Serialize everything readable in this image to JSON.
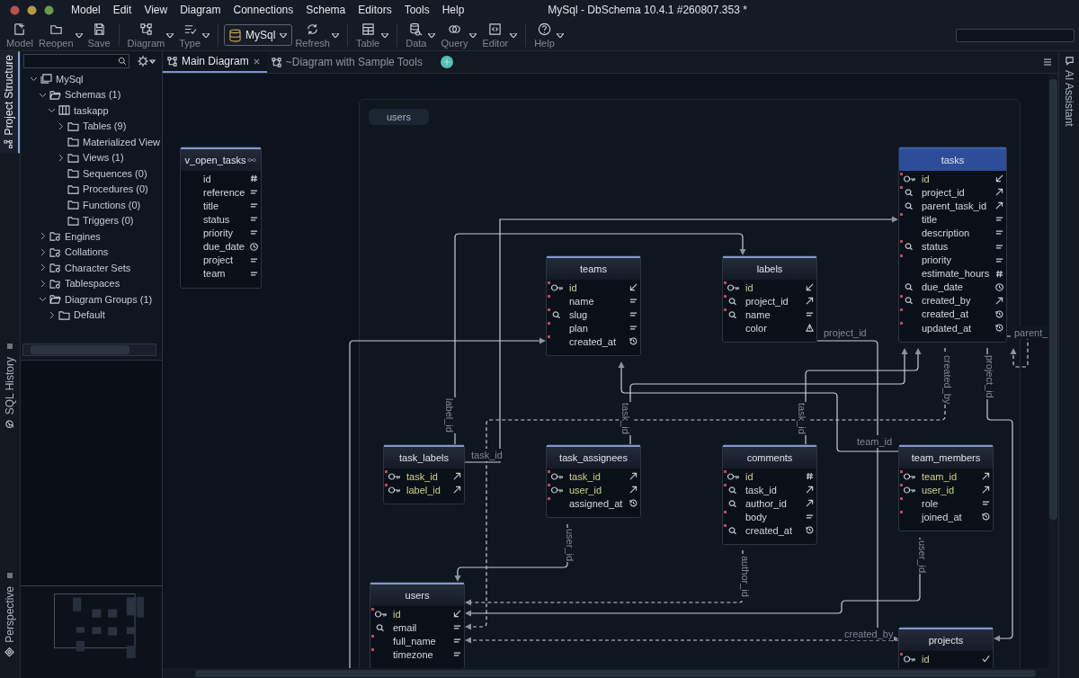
{
  "window": {
    "title": "MySql - DbSchema 10.4.1 #260807.353 *"
  },
  "menu": [
    "Model",
    "Edit",
    "View",
    "Diagram",
    "Connections",
    "Schema",
    "Editors",
    "Tools",
    "Help"
  ],
  "toolbar": [
    {
      "label": "Model",
      "kind": "button",
      "dropdown": false
    },
    {
      "label": "Reopen",
      "kind": "button",
      "dropdown": true
    },
    {
      "label": "Save",
      "kind": "button",
      "dropdown": false
    },
    {
      "label": "Diagram",
      "kind": "button",
      "dropdown": true
    },
    {
      "label": "Type",
      "kind": "button",
      "dropdown": true
    },
    {
      "label": "MySql",
      "kind": "selector",
      "dropdown": true
    },
    {
      "label": "Refresh",
      "kind": "button",
      "dropdown": true
    },
    {
      "label": "Table",
      "kind": "button",
      "dropdown": true
    },
    {
      "label": "Data",
      "kind": "button",
      "dropdown": true
    },
    {
      "label": "Query",
      "kind": "button",
      "dropdown": true
    },
    {
      "label": "Editor",
      "kind": "button",
      "dropdown": true
    },
    {
      "label": "Help",
      "kind": "button",
      "dropdown": true
    }
  ],
  "side_tabs_left": [
    {
      "label": "Project Structure",
      "selected": true
    },
    {
      "label": "SQL History",
      "selected": false
    },
    {
      "label": "Perspective",
      "selected": false
    }
  ],
  "side_tabs_right": [
    {
      "label": "AI Assistant",
      "selected": false
    }
  ],
  "tree": [
    {
      "label": "MySql",
      "kind": "connection",
      "expanded": true,
      "children": [
        {
          "label": "Schemas (1)",
          "kind": "folder-open",
          "expanded": true,
          "children": [
            {
              "label": "taskapp",
              "kind": "schema",
              "expanded": true,
              "children": [
                {
                  "label": "Tables (9)",
                  "kind": "folder",
                  "expanded": false
                },
                {
                  "label": "Materialized View",
                  "kind": "folder"
                },
                {
                  "label": "Views (1)",
                  "kind": "folder",
                  "expanded": false
                },
                {
                  "label": "Sequences (0)",
                  "kind": "folder"
                },
                {
                  "label": "Procedures (0)",
                  "kind": "folder"
                },
                {
                  "label": "Functions (0)",
                  "kind": "folder"
                },
                {
                  "label": "Triggers (0)",
                  "kind": "folder"
                }
              ]
            }
          ]
        },
        {
          "label": "Engines",
          "kind": "folder-special",
          "expanded": false
        },
        {
          "label": "Collations",
          "kind": "folder-special",
          "expanded": false
        },
        {
          "label": "Character Sets",
          "kind": "folder-special",
          "expanded": false
        },
        {
          "label": "Tablespaces",
          "kind": "folder-special",
          "expanded": false
        },
        {
          "label": "Diagram Groups (1)",
          "kind": "folder-open",
          "expanded": true,
          "children": [
            {
              "label": "Default",
              "kind": "folder",
              "expanded": false
            }
          ]
        }
      ]
    }
  ],
  "tabs": [
    {
      "label": "Main Diagram",
      "selected": true
    },
    {
      "label": "~Diagram with Sample Tools",
      "selected": false
    }
  ],
  "diagram": {
    "group": {
      "label": "users"
    },
    "tables": [
      {
        "name": "v_open_tasks",
        "kind": "view",
        "selected": false,
        "columns": [
          {
            "name": "id",
            "primary_key": false,
            "indexed": false,
            "kind": "number",
            "required": false
          },
          {
            "name": "reference",
            "primary_key": false,
            "indexed": false,
            "kind": "text",
            "required": false
          },
          {
            "name": "title",
            "primary_key": false,
            "indexed": false,
            "kind": "text",
            "required": false
          },
          {
            "name": "status",
            "primary_key": false,
            "indexed": false,
            "kind": "text",
            "required": false
          },
          {
            "name": "priority",
            "primary_key": false,
            "indexed": false,
            "kind": "text",
            "required": false
          },
          {
            "name": "due_date",
            "primary_key": false,
            "indexed": false,
            "kind": "date",
            "required": false
          },
          {
            "name": "project",
            "primary_key": false,
            "indexed": false,
            "kind": "text",
            "required": false
          },
          {
            "name": "team",
            "primary_key": false,
            "indexed": false,
            "kind": "text",
            "required": false
          }
        ]
      },
      {
        "name": "tasks",
        "kind": "table",
        "selected": true,
        "columns": [
          {
            "name": "id",
            "primary_key": true,
            "indexed": false,
            "kind": "pk",
            "required": true
          },
          {
            "name": "project_id",
            "primary_key": false,
            "indexed": true,
            "kind": "fk",
            "required": true
          },
          {
            "name": "parent_task_id",
            "primary_key": false,
            "indexed": true,
            "kind": "fk",
            "required": false
          },
          {
            "name": "title",
            "primary_key": false,
            "indexed": false,
            "kind": "text",
            "required": true
          },
          {
            "name": "description",
            "primary_key": false,
            "indexed": false,
            "kind": "text",
            "required": false
          },
          {
            "name": "status",
            "primary_key": false,
            "indexed": true,
            "kind": "text",
            "required": true
          },
          {
            "name": "priority",
            "primary_key": false,
            "indexed": false,
            "kind": "text",
            "required": true
          },
          {
            "name": "estimate_hours",
            "primary_key": false,
            "indexed": false,
            "kind": "number",
            "required": false
          },
          {
            "name": "due_date",
            "primary_key": false,
            "indexed": true,
            "kind": "date",
            "required": false
          },
          {
            "name": "created_by",
            "primary_key": false,
            "indexed": true,
            "kind": "fk",
            "required": true
          },
          {
            "name": "created_at",
            "primary_key": false,
            "indexed": false,
            "kind": "history",
            "required": true
          },
          {
            "name": "updated_at",
            "primary_key": false,
            "indexed": false,
            "kind": "history",
            "required": true
          }
        ]
      },
      {
        "name": "teams",
        "kind": "table",
        "selected": false,
        "columns": [
          {
            "name": "id",
            "primary_key": true,
            "indexed": false,
            "kind": "pk",
            "required": true
          },
          {
            "name": "name",
            "primary_key": false,
            "indexed": false,
            "kind": "text",
            "required": true
          },
          {
            "name": "slug",
            "primary_key": false,
            "indexed": true,
            "kind": "text",
            "required": true
          },
          {
            "name": "plan",
            "primary_key": false,
            "indexed": false,
            "kind": "text",
            "required": true
          },
          {
            "name": "created_at",
            "primary_key": false,
            "indexed": false,
            "kind": "history",
            "required": true
          }
        ]
      },
      {
        "name": "labels",
        "kind": "table",
        "selected": false,
        "columns": [
          {
            "name": "id",
            "primary_key": true,
            "indexed": false,
            "kind": "pk",
            "required": true
          },
          {
            "name": "project_id",
            "primary_key": false,
            "indexed": true,
            "kind": "fk",
            "required": true
          },
          {
            "name": "name",
            "primary_key": false,
            "indexed": true,
            "kind": "text",
            "required": true
          },
          {
            "name": "color",
            "primary_key": false,
            "indexed": false,
            "kind": "enum",
            "required": false
          }
        ]
      },
      {
        "name": "task_labels",
        "kind": "table",
        "selected": false,
        "columns": [
          {
            "name": "task_id",
            "primary_key": true,
            "indexed": false,
            "kind": "fk",
            "required": true
          },
          {
            "name": "label_id",
            "primary_key": true,
            "indexed": false,
            "kind": "fk",
            "required": true
          }
        ]
      },
      {
        "name": "task_assignees",
        "kind": "table",
        "selected": false,
        "columns": [
          {
            "name": "task_id",
            "primary_key": true,
            "indexed": false,
            "kind": "fk",
            "required": true
          },
          {
            "name": "user_id",
            "primary_key": true,
            "indexed": false,
            "kind": "fk",
            "required": true
          },
          {
            "name": "assigned_at",
            "primary_key": false,
            "indexed": false,
            "kind": "history",
            "required": true
          }
        ]
      },
      {
        "name": "comments",
        "kind": "table",
        "selected": false,
        "columns": [
          {
            "name": "id",
            "primary_key": true,
            "indexed": false,
            "kind": "number",
            "required": true
          },
          {
            "name": "task_id",
            "primary_key": false,
            "indexed": true,
            "kind": "fk",
            "required": true
          },
          {
            "name": "author_id",
            "primary_key": false,
            "indexed": true,
            "kind": "fk",
            "required": false
          },
          {
            "name": "body",
            "primary_key": false,
            "indexed": false,
            "kind": "text",
            "required": true
          },
          {
            "name": "created_at",
            "primary_key": false,
            "indexed": true,
            "kind": "history",
            "required": true
          }
        ]
      },
      {
        "name": "team_members",
        "kind": "table",
        "selected": false,
        "columns": [
          {
            "name": "team_id",
            "primary_key": true,
            "indexed": false,
            "kind": "fk",
            "required": true
          },
          {
            "name": "user_id",
            "primary_key": true,
            "indexed": false,
            "kind": "fk",
            "required": true
          },
          {
            "name": "role",
            "primary_key": false,
            "indexed": false,
            "kind": "text",
            "required": true
          },
          {
            "name": "joined_at",
            "primary_key": false,
            "indexed": false,
            "kind": "history",
            "required": true
          }
        ]
      },
      {
        "name": "users",
        "kind": "table",
        "selected": false,
        "columns": [
          {
            "name": "id",
            "primary_key": true,
            "indexed": false,
            "kind": "pk",
            "required": true
          },
          {
            "name": "email",
            "primary_key": false,
            "indexed": true,
            "kind": "text",
            "required": false
          },
          {
            "name": "full_name",
            "primary_key": false,
            "indexed": false,
            "kind": "text",
            "required": true
          },
          {
            "name": "timezone",
            "primary_key": false,
            "indexed": false,
            "kind": "text",
            "required": true
          }
        ]
      },
      {
        "name": "projects",
        "kind": "table",
        "selected": false,
        "columns": [
          {
            "name": "id",
            "primary_key": true,
            "indexed": false,
            "kind": "check",
            "required": true
          }
        ]
      }
    ],
    "relation_labels": [
      {
        "text": "project_id",
        "kind": "horizontal"
      },
      {
        "text": "parent_",
        "kind": "horizontal"
      },
      {
        "text": "label_id",
        "kind": "vertical"
      },
      {
        "text": "task_id",
        "kind": "horizontal"
      },
      {
        "text": "task_id",
        "kind": "vertical"
      },
      {
        "text": "task_id",
        "kind": "vertical"
      },
      {
        "text": "created_by",
        "kind": "vertical"
      },
      {
        "text": "project_id",
        "kind": "vertical"
      },
      {
        "text": "team_id",
        "kind": "horizontal"
      },
      {
        "text": "user_id",
        "kind": "vertical"
      },
      {
        "text": "author_id",
        "kind": "vertical"
      },
      {
        "text": "user_id",
        "kind": "vertical"
      },
      {
        "text": "created_by",
        "kind": "horizontal"
      }
    ]
  }
}
